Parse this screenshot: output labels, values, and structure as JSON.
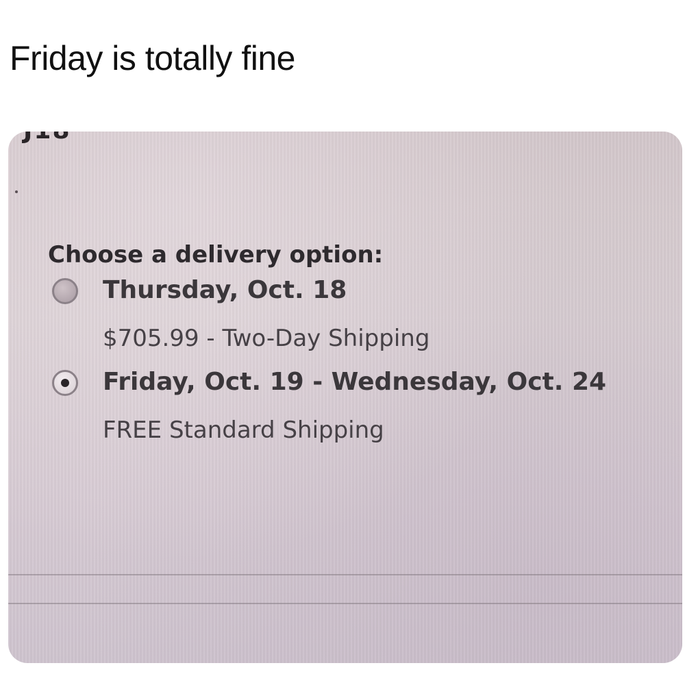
{
  "caption": "Friday is totally fine",
  "screen": {
    "cut_off_text": "J18",
    "heading": "Choose a delivery option:",
    "options": [
      {
        "date": "Thursday, Oct. 18",
        "detail": "$705.99 - Two-Day Shipping",
        "selected": false
      },
      {
        "date": "Friday, Oct. 19 - Wednesday, Oct. 24",
        "detail": "FREE Standard Shipping",
        "selected": true
      }
    ]
  },
  "colors": {
    "screen_tint": "#d6cad0",
    "text": "#3b373b"
  }
}
